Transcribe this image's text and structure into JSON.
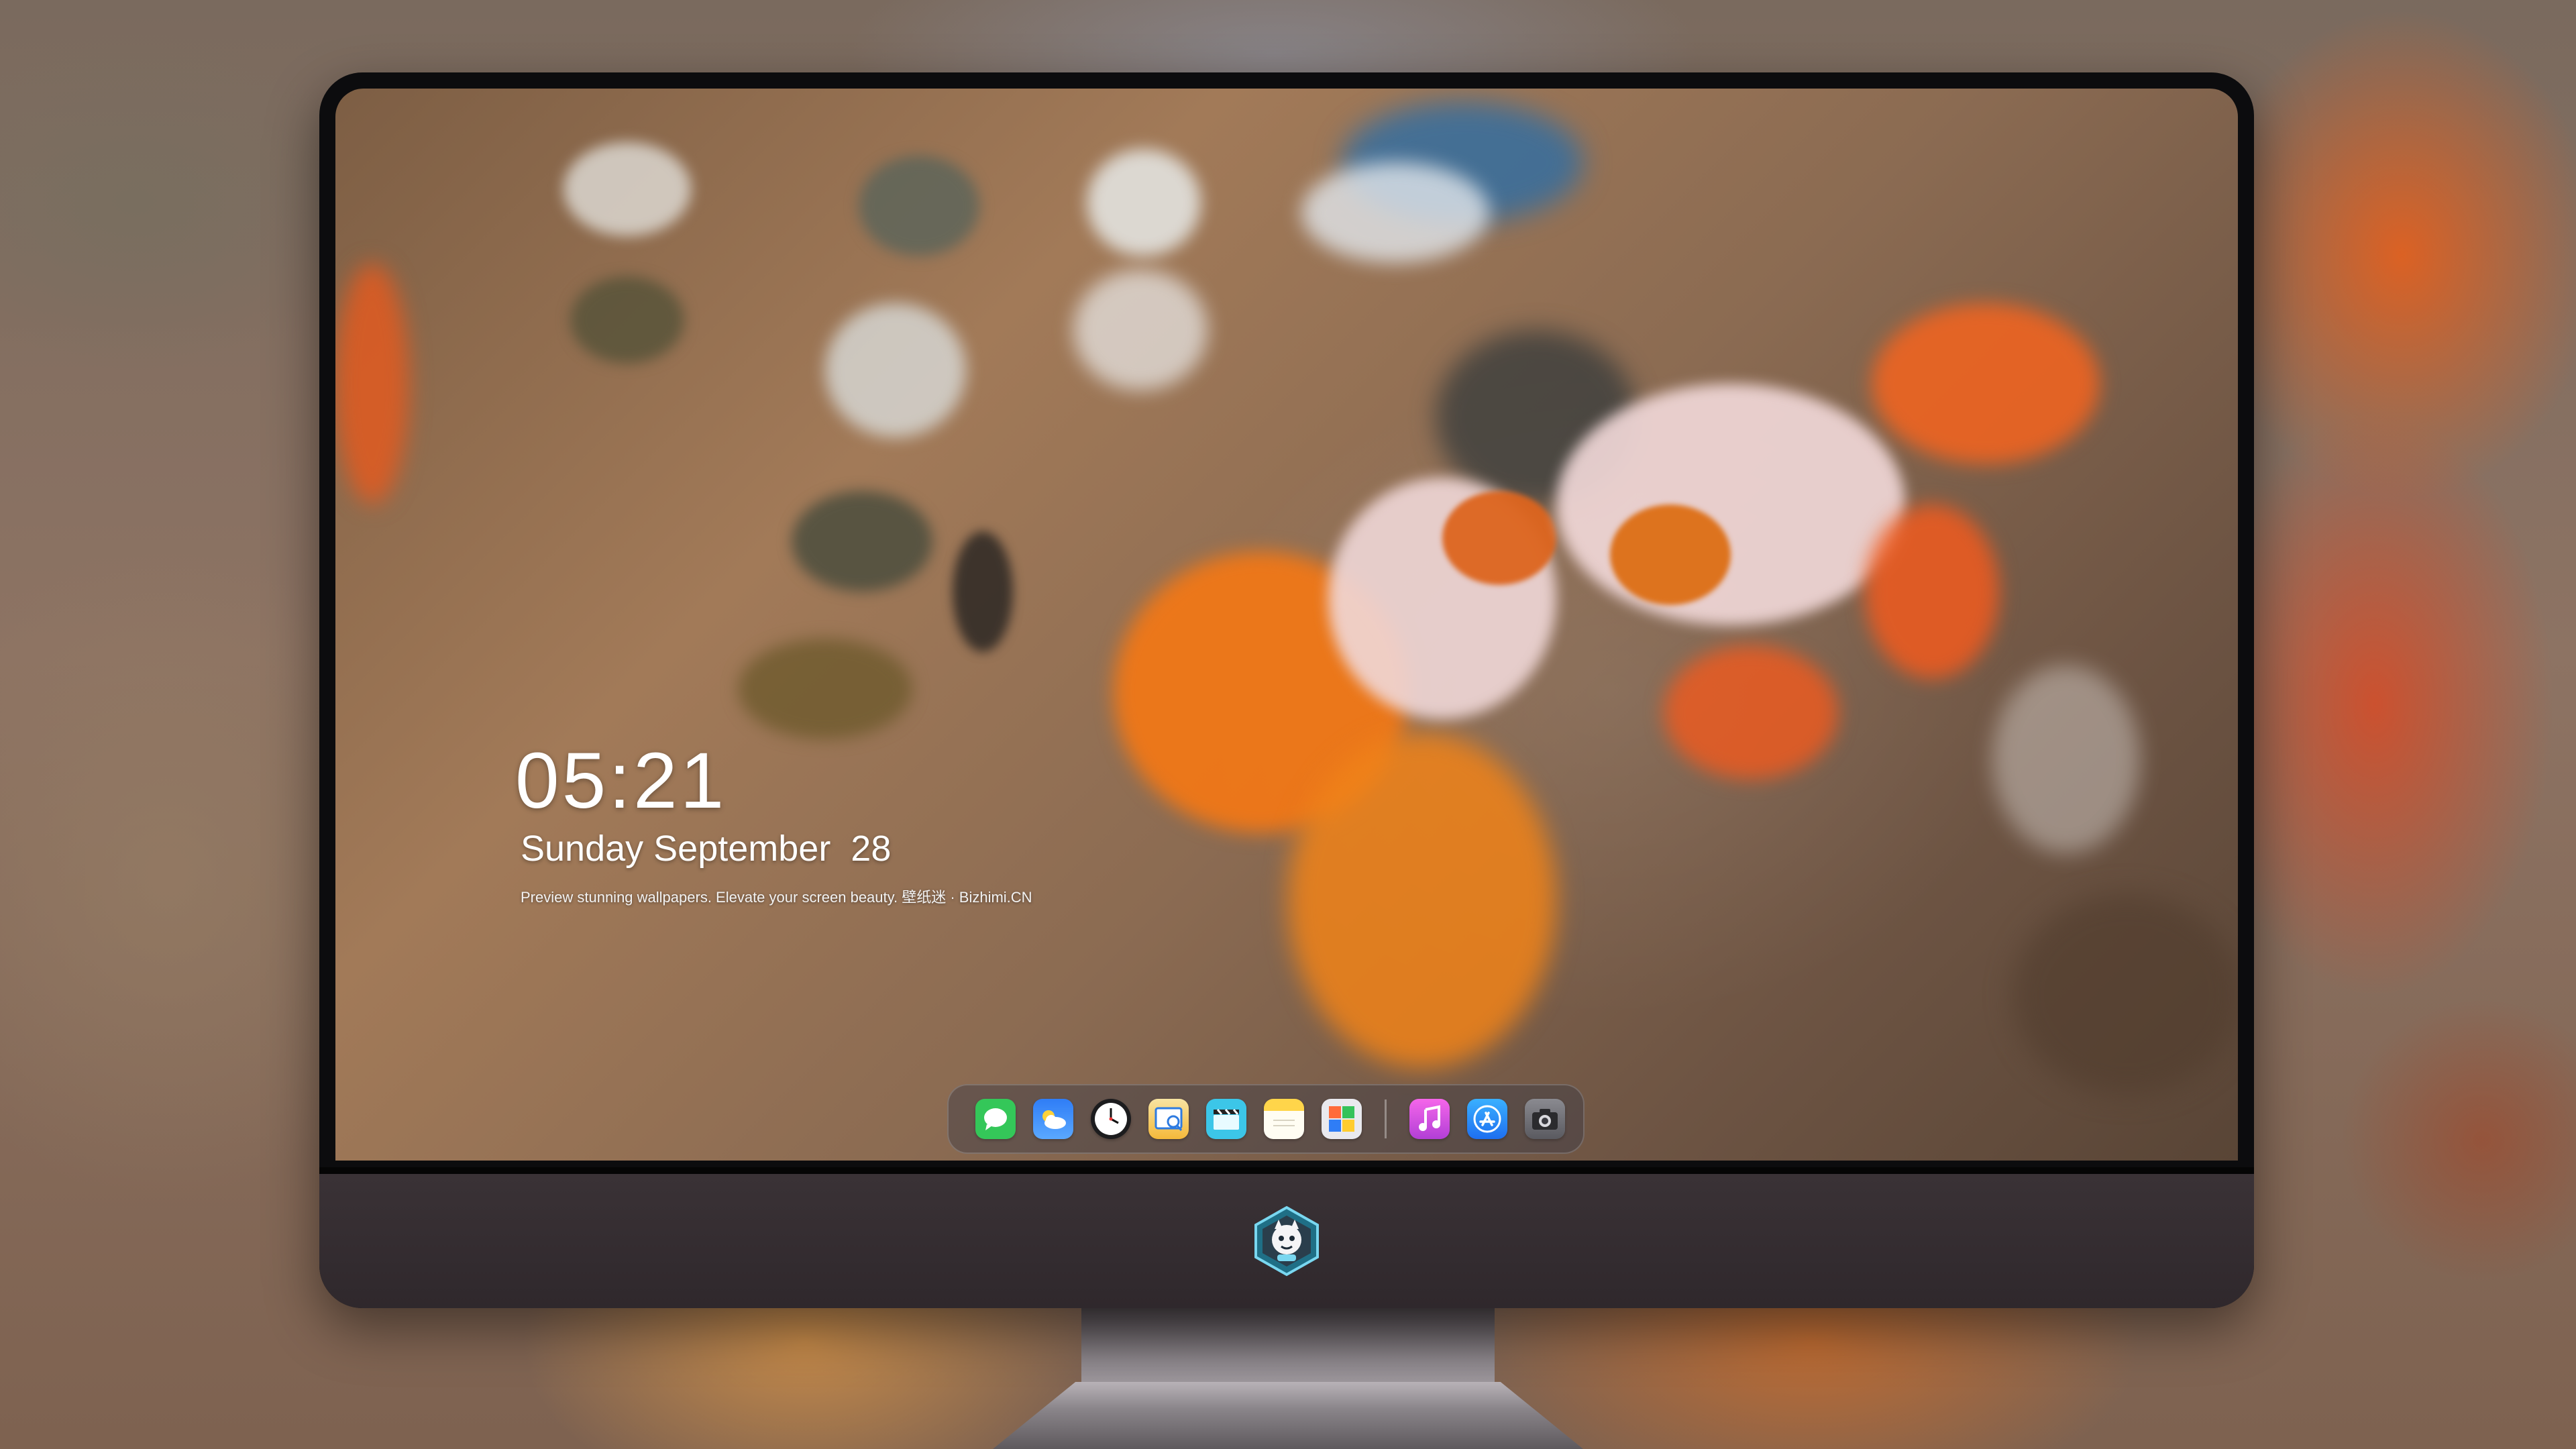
{
  "lock_screen": {
    "time": "05:21",
    "date": "Sunday September  28",
    "tagline": "Preview stunning wallpapers. Elevate your screen beauty. 壁纸迷 · Bizhimi.CN"
  },
  "dock": {
    "apps": [
      {
        "icon": "messages-icon",
        "color": "#34c759"
      },
      {
        "icon": "weather-icon",
        "color": "#2f7df6"
      },
      {
        "icon": "clock-icon",
        "color": "#1c1c1e"
      },
      {
        "icon": "preview-icon",
        "color": "#f5b93a"
      },
      {
        "icon": "claquette-icon",
        "color": "#3cc6e8"
      },
      {
        "icon": "notes-icon",
        "color": "#ffd54a"
      },
      {
        "icon": "photo-booth-icon",
        "color": "#e9e9ee"
      },
      {
        "icon": "music-icon",
        "color": "#e94dd8"
      },
      {
        "icon": "app-store-icon",
        "color": "#1e8cf0"
      },
      {
        "icon": "camera-icon",
        "color": "#6b6b70"
      }
    ]
  },
  "monitor": {
    "logo_icon": "mascot-logo-icon",
    "bezel_color": "#0c0c0e",
    "chin_color": "#352d31"
  }
}
